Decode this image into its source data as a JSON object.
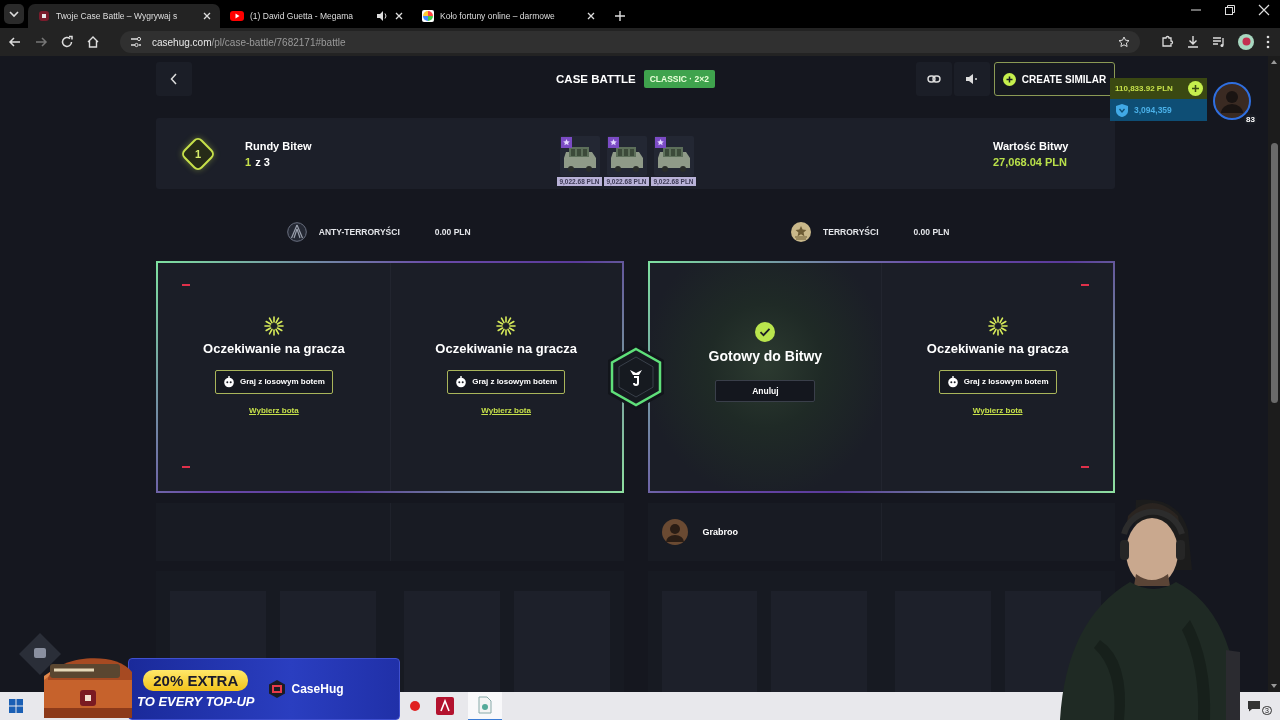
{
  "browser": {
    "tabs": [
      {
        "title": "Twoje Case Battle – Wygrywaj s",
        "kind": "site",
        "selected": true,
        "audio": false
      },
      {
        "title": "(1) David Guetta - Megama",
        "kind": "video",
        "selected": false,
        "audio": true
      },
      {
        "title": "Koło fortuny online – darmowe",
        "kind": "wheel",
        "selected": false,
        "audio": false
      }
    ],
    "url_host": "casehug.com",
    "url_path": "/pl/case-battle/7682171#battle"
  },
  "header": {
    "title": "CASE BATTLE",
    "mode_badge": "CLASSIC · 2×2",
    "create_button": "CREATE SIMILAR"
  },
  "account": {
    "balance": "110,833.92 PLN",
    "points": "3,094,359",
    "level": "83"
  },
  "rounds": {
    "badge": "1",
    "label": "Rundy Bitew",
    "current": "1",
    "total": "z 3"
  },
  "cases": [
    {
      "price": "9,022.68 PLN"
    },
    {
      "price": "9,022.68 PLN"
    },
    {
      "price": "9,022.68 PLN"
    }
  ],
  "battle_value": {
    "label": "Wartość Bitwy",
    "value": "27,068.04 PLN"
  },
  "teams": [
    {
      "name": "ANTY-TERRORYŚCI",
      "kind": "ct",
      "total": "0.00 PLN",
      "slots": [
        {
          "kind": "waiting",
          "title": "Oczekiwanie na gracza",
          "button": "Graj z losowym botem",
          "link": "Wybierz bota"
        },
        {
          "kind": "waiting",
          "title": "Oczekiwanie na gracza",
          "button": "Graj z losowym botem",
          "link": "Wybierz bota"
        }
      ]
    },
    {
      "name": "TERRORYŚCI",
      "kind": "t",
      "total": "0.00 PLN",
      "slots": [
        {
          "kind": "ready",
          "title": "Gotowy do Bitwy",
          "button": "Anuluj",
          "player": "Grabroo"
        },
        {
          "kind": "waiting",
          "title": "Oczekiwanie na gracza",
          "button": "Graj z losowym botem",
          "link": "Wybierz bota"
        }
      ]
    }
  ],
  "promo": {
    "headline": "20% EXTRA",
    "subline": "TO EVERY TOP-UP",
    "brand": "CaseHug"
  },
  "taskbar": {
    "notification_count": "3"
  }
}
